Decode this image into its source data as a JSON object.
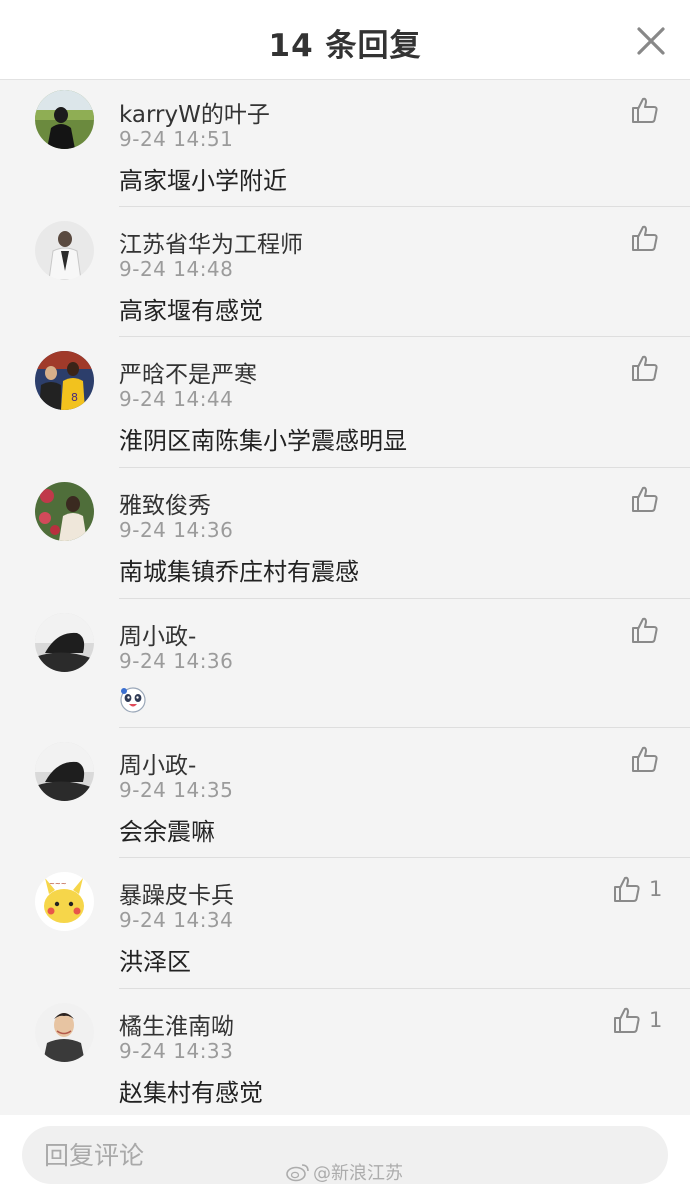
{
  "header": {
    "title": "14 条回复",
    "close_icon": "close-icon"
  },
  "colors": {
    "background": "#f4f4f4",
    "text": "#333333",
    "muted": "#9b9b9b"
  },
  "replies": [
    {
      "username": "karryW的叶子",
      "time": "9-24 14:51",
      "content": "高家堰小学附近",
      "likes": ""
    },
    {
      "username": "江苏省华为工程师",
      "time": "9-24 14:48",
      "content": "高家堰有感觉",
      "likes": ""
    },
    {
      "username": "严晗不是严寒",
      "time": "9-24 14:44",
      "content": "淮阴区南陈集小学震感明显",
      "likes": ""
    },
    {
      "username": "雅致俊秀",
      "time": "9-24 14:36",
      "content": "南城集镇乔庄村有震感",
      "likes": ""
    },
    {
      "username": "周小政-",
      "time": "9-24 14:36",
      "content": "",
      "content_icon": "panda-emoji-icon",
      "likes": ""
    },
    {
      "username": "周小政-",
      "time": "9-24 14:35",
      "content": "会余震嘛",
      "likes": ""
    },
    {
      "username": "暴躁皮卡兵",
      "time": "9-24 14:34",
      "content": "洪泽区",
      "likes": "1"
    },
    {
      "username": "橘生淮南呦",
      "time": "9-24 14:33",
      "content": "赵集村有感觉",
      "likes": "1"
    }
  ],
  "footer": {
    "reply_placeholder": "回复评论",
    "watermark": "@新浪江苏"
  }
}
